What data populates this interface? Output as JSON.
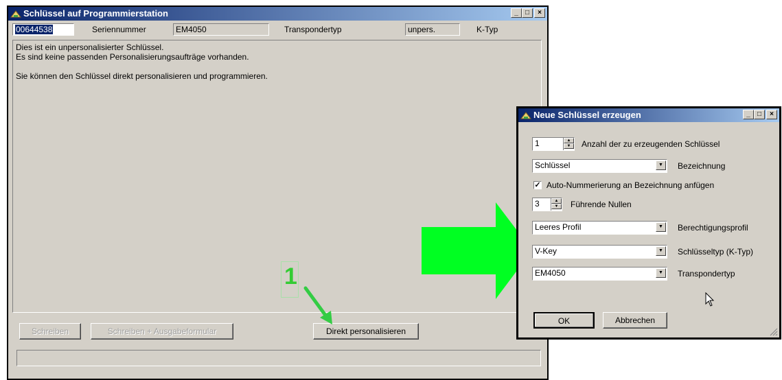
{
  "main_window": {
    "title": "Schlüssel auf Programmierstation",
    "serial_value": "00644538",
    "serial_label": "Seriennummer",
    "transponder_value": "EM4050",
    "transponder_label": "Transpondertyp",
    "ktype_value": "unpers.",
    "ktype_label": "K-Typ",
    "message_lines": [
      "Dies ist ein unpersonalisierter Schlüssel.",
      "Es sind keine passenden Personalisierungsaufträge vorhanden.",
      "",
      "Sie können den Schlüssel direkt personalisieren und programmieren."
    ],
    "btn_write": "Schreiben",
    "btn_write_form": "Schreiben + Ausgabeformular",
    "btn_direct": "Direkt personalisieren"
  },
  "annotation": {
    "step_number": "1",
    "arrow_color": "#22cc44",
    "big_arrow_color": "#00ff22"
  },
  "dialog": {
    "title": "Neue Schlüssel erzeugen",
    "count_value": "1",
    "count_label": "Anzahl der zu erzeugenden Schlüssel",
    "name_value": "Schlüssel",
    "name_label": "Bezeichnung",
    "autonum_checked": true,
    "autonum_label": "Auto-Nummerierung an Bezeichnung anfügen",
    "zeros_value": "3",
    "zeros_label": "Führende Nullen",
    "profile_value": "Leeres Profil",
    "profile_label": "Berechtigungsprofil",
    "keytype_value": "V-Key",
    "keytype_label": "Schlüsseltyp (K-Typ)",
    "transponder_value": "EM4050",
    "transponder_label": "Transpondertyp",
    "ok": "OK",
    "cancel": "Abbrechen"
  },
  "colors": {
    "titlebar_start": "#0a246a",
    "titlebar_end": "#a6caf0",
    "window_bg": "#d4d0c8"
  }
}
